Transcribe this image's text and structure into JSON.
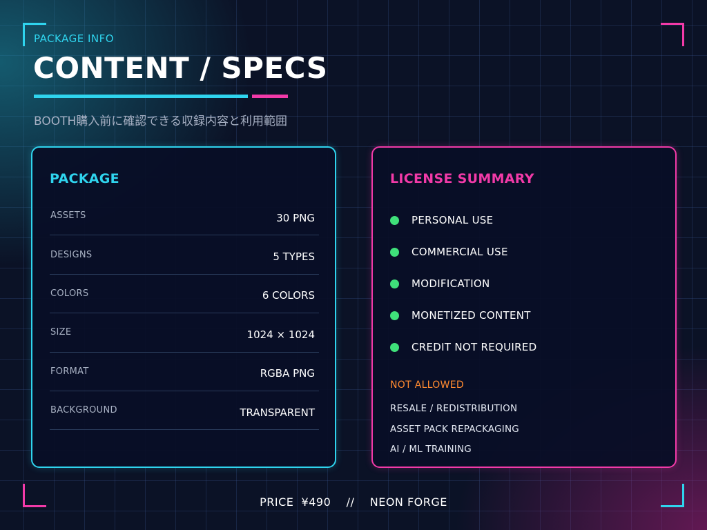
{
  "header": {
    "kicker": "PACKAGE INFO",
    "title": "CONTENT / SPECS",
    "subtitle": "BOOTH購入前に確認できる収録内容と利用範囲"
  },
  "package_panel": {
    "heading": "PACKAGE",
    "rows": [
      {
        "label": "ASSETS",
        "value": "30 PNG"
      },
      {
        "label": "DESIGNS",
        "value": "5 TYPES"
      },
      {
        "label": "COLORS",
        "value": "6 COLORS"
      },
      {
        "label": "SIZE",
        "value": "1024 × 1024"
      },
      {
        "label": "FORMAT",
        "value": "RGBA PNG"
      },
      {
        "label": "BACKGROUND",
        "value": "TRANSPARENT"
      }
    ]
  },
  "license_panel": {
    "heading": "LICENSE SUMMARY",
    "allowed": [
      "PERSONAL USE",
      "COMMERCIAL USE",
      "MODIFICATION",
      "MONETIZED CONTENT",
      "CREDIT NOT REQUIRED"
    ],
    "not_allowed_heading": "NOT ALLOWED",
    "not_allowed": [
      "RESALE / REDISTRIBUTION",
      "ASSET PACK REPACKAGING",
      "AI / ML TRAINING"
    ]
  },
  "footer": {
    "text": "PRICE  ¥490    //    NEON FORGE"
  },
  "colors": {
    "accent_cyan": "#2fd4ee",
    "accent_pink": "#f23aa8",
    "allowed_green": "#3fe07a",
    "not_allowed_orange": "#ff8a30",
    "background": "#0b1226"
  },
  "icons": {
    "allowed_marker": "green-dot-icon"
  }
}
